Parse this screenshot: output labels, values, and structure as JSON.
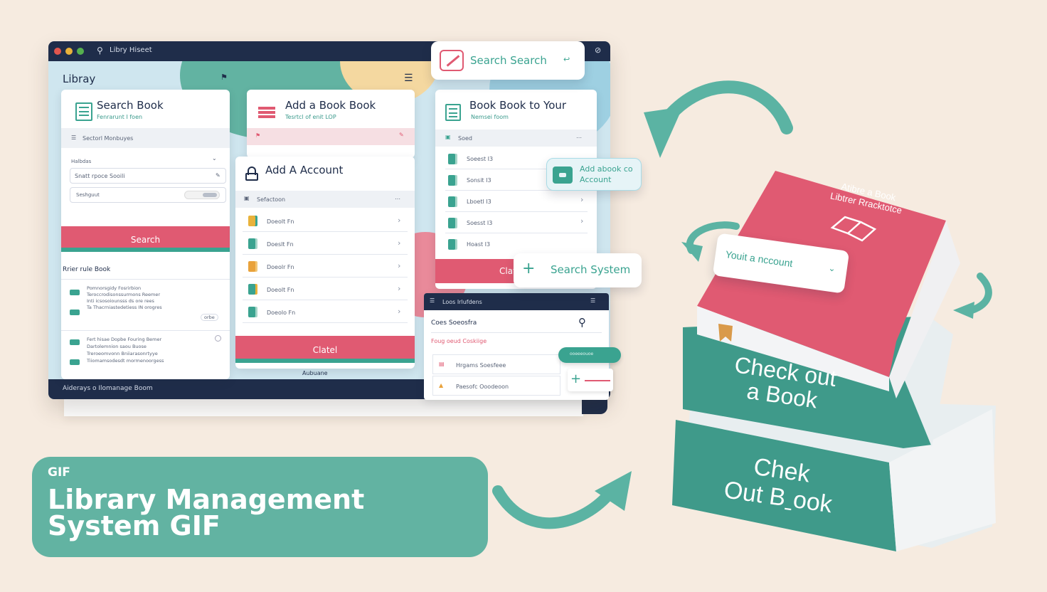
{
  "window": {
    "title_bar_text": "Libry Hiseet",
    "app_title": "Libray",
    "status_bar_text": "Aiderays o Ilomanage Boom"
  },
  "search_card": {
    "title": "Search Book",
    "subtitle": "Fenrarunt I foen",
    "section": "Sectorl Monbuyes",
    "field_label": "Halbdas",
    "search_placeholder": "Snatt rpoce Sooili",
    "field2_placeholder": "Seshguut",
    "button": "Search",
    "results_heading": "Rrier rule Book",
    "results": [
      {
        "lines": [
          "Pomnorsgidy Fosrirbion",
          "Teroccrodisonssurmons Reemer",
          "Inti icsosoiounsss ds ore rees",
          "Ta Thacrniastedetiess IN orogres"
        ],
        "badge": "orbe"
      },
      {
        "lines": [
          "Fert hisae Dopbe Fouring Bemer",
          "Dartolemnion saou Buose",
          "Treroeomvonn Bniiarasonrtyye",
          "Tiiomamsodesdt mormenoorgess"
        ],
        "badge": ""
      }
    ]
  },
  "add_book_card": {
    "title": "Add a Book Book",
    "subtitle": "Tesrtcl of enit LOP"
  },
  "account_card": {
    "title": "Add A Account",
    "section": "Sefactoon",
    "items": [
      "Doeolt Fn",
      "Doeslt Fn",
      "Doeolr Fn",
      "Doeolt Fn",
      "Doeolo Fn"
    ],
    "button": "Clatel",
    "footer": "Aubuane"
  },
  "right_card": {
    "title": "Book Book to Your",
    "subtitle": "Nemsei foom",
    "section": "Soed",
    "items": [
      "Soeest I3",
      "Sonsit I3",
      "Lboetl I3",
      "Soesst I3",
      "Hoast I3"
    ],
    "button": "Clat"
  },
  "mini_panel": {
    "header": "Loos Irlufdens",
    "search_label": "Coes Soeosfra",
    "red_text": "Foug oeud Coskiige",
    "pill": "ooeeeouoe",
    "rows": [
      "Hrgams Soesfeee",
      "Paesofc Ooodeoon"
    ]
  },
  "floating": {
    "search_search": "Search Search",
    "search_search_arrow": "↩",
    "add_account": [
      "Add abook co",
      "Account"
    ],
    "search_system": "Search System",
    "plus": "+"
  },
  "banner": {
    "tag": "GIF",
    "title_line1": "Library Management",
    "title_line2": "System GIF"
  },
  "books": {
    "red_cover": [
      "Atibre a Book",
      "Libtrer Rracktotce"
    ],
    "account_tag": "Youit a nccount",
    "middle": [
      "Check out",
      "a Book"
    ],
    "bottom": [
      "Chek",
      "Out Bˍook"
    ]
  },
  "colors": {
    "navy": "#1f2d4a",
    "teal": "#3aa390",
    "coral": "#e05a72",
    "background": "#f6ebe0"
  }
}
